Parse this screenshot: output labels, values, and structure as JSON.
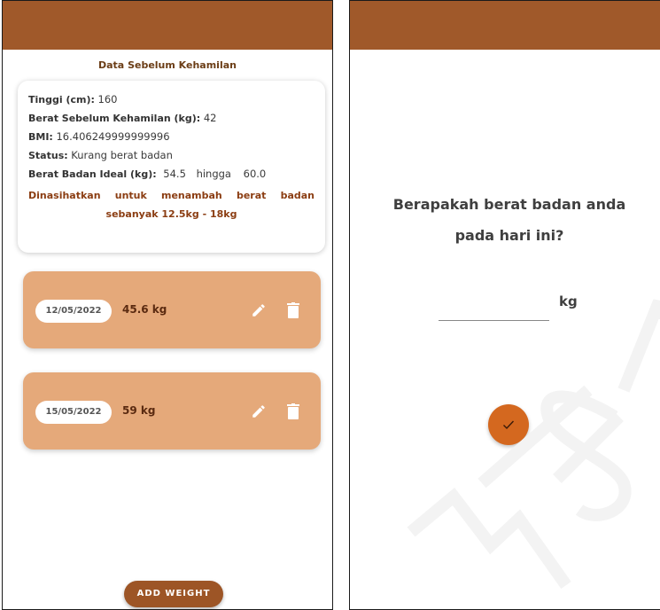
{
  "theme": {
    "header_color": "#a0592a",
    "card_color": "#e5a97a",
    "button_color": "#9d5526",
    "fab_color": "#d4681f"
  },
  "left_screen": {
    "section_title": "Data Sebelum Kehamilan",
    "info": {
      "height_label": "Tinggi (cm):",
      "height_value": "160",
      "prepreg_weight_label": "Berat Sebelum Kehamilan (kg):",
      "prepreg_weight_value": "42",
      "bmi_label": "BMI:",
      "bmi_value": "16.406249999999996",
      "status_label": "Status:",
      "status_value": "Kurang berat badan",
      "ideal_label": "Berat Badan Ideal (kg):",
      "ideal_min": "54.5",
      "ideal_separator": "hingga",
      "ideal_max": "60.0",
      "advice": "Dinasihatkan untuk menambah berat badan sebanyak 12.5kg - 18kg"
    },
    "entries": [
      {
        "date": "12/05/2022",
        "weight": "45.6 kg"
      },
      {
        "date": "15/05/2022",
        "weight": "59 kg"
      }
    ],
    "add_button_label": "ADD WEIGHT"
  },
  "right_screen": {
    "question": "Berapakah berat badan anda pada hari ini?",
    "input_value": "",
    "unit": "kg"
  },
  "icons": {
    "edit": "pencil-icon",
    "delete": "trash-icon",
    "confirm": "check-icon"
  }
}
